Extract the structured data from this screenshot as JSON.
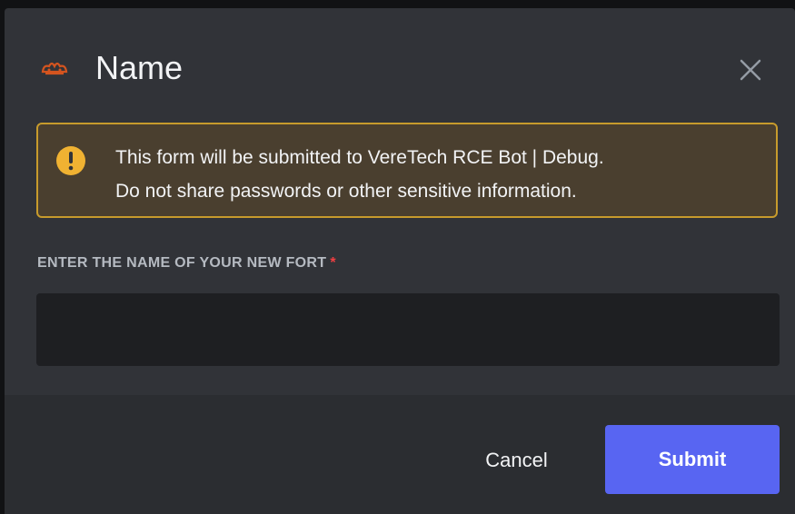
{
  "modal": {
    "title": "Name",
    "app_icon": "bot-avatar-icon",
    "close_icon": "close-icon"
  },
  "notice": {
    "icon": "exclamation-icon",
    "line1": "This form will be submitted to VereTech RCE Bot | Debug.",
    "line2": "Do not share passwords or other sensitive information.",
    "border_color": "#c79b2c",
    "background_color": "#4a3f2f"
  },
  "field": {
    "label": "ENTER THE NAME OF YOUR NEW FORT",
    "required_marker": "*",
    "value": "",
    "placeholder": ""
  },
  "footer": {
    "cancel_label": "Cancel",
    "submit_label": "Submit",
    "submit_color": "#5865f2"
  }
}
